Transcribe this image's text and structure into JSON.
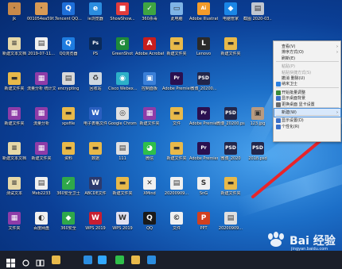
{
  "desktop": {
    "icons": [
      {
        "label": "jk",
        "color": "#c98a4a",
        "glyph": "·",
        "col": 0,
        "row": 0
      },
      {
        "label": "001054ea59f...",
        "color": "#d89a55",
        "glyph": "·",
        "col": 1,
        "row": 0
      },
      {
        "label": "Tencent QQ...",
        "color": "#1e6fd9",
        "glyph": "Q",
        "col": 2,
        "row": 0
      },
      {
        "label": "ie浏览器",
        "color": "#2b8de0",
        "glyph": "e",
        "col": 3,
        "row": 0
      },
      {
        "label": "ShowShow...",
        "color": "#e23c3c",
        "glyph": "■",
        "col": 4,
        "row": 0
      },
      {
        "label": "360杀毒",
        "color": "#3fa542",
        "glyph": "✓",
        "col": 5,
        "row": 0
      },
      {
        "label": "此电脑",
        "color": "#7fb4e6",
        "glyph": "▭",
        "col": 6,
        "row": 0
      },
      {
        "label": "Adobe Illustrat...",
        "color": "#f39b2a",
        "glyph": "Ai",
        "col": 7,
        "row": 0
      },
      {
        "label": "电脑管家",
        "color": "#1a86e6",
        "glyph": "◆",
        "col": 8,
        "row": 0
      },
      {
        "label": "截图 2020-03...",
        "color": "#c0c6d0",
        "glyph": "▤",
        "col": 9,
        "row": 0
      },
      {
        "label": "新建文本文档",
        "color": "#e6d8a8",
        "glyph": "≡",
        "col": 0,
        "row": 1
      },
      {
        "label": "2019-07-11...",
        "color": "#f0f0f0",
        "glyph": "▤",
        "col": 1,
        "row": 1
      },
      {
        "label": "QQ浏览器",
        "color": "#1e7ce0",
        "glyph": "Q",
        "col": 2,
        "row": 1
      },
      {
        "label": "PS",
        "color": "#0a2a5a",
        "glyph": "Ps",
        "col": 3,
        "row": 1
      },
      {
        "label": "GreenShot",
        "color": "#1e8a3a",
        "glyph": "G",
        "col": 4,
        "row": 1
      },
      {
        "label": "Adobe Acrobat",
        "color": "#c81e1e",
        "glyph": "A",
        "col": 5,
        "row": 1
      },
      {
        "label": "新建文件夹",
        "color": "#e8b94a",
        "glyph": "▬",
        "col": 6,
        "row": 1
      },
      {
        "label": "Lenovo",
        "color": "#2a2a2a",
        "glyph": "L",
        "col": 7,
        "row": 1
      },
      {
        "label": "新建文件夹",
        "color": "#e8b94a",
        "glyph": "▬",
        "col": 8,
        "row": 1
      },
      {
        "label": "新建文件夹",
        "color": "#e8b94a",
        "glyph": "▬",
        "col": 0,
        "row": 2
      },
      {
        "label": "流量分析 统计文件夹",
        "color": "#8e3ca8",
        "glyph": "▦",
        "col": 1,
        "row": 2
      },
      {
        "label": "encrypting",
        "color": "#d8d8d8",
        "glyph": "▤",
        "col": 2,
        "row": 2
      },
      {
        "label": "回收站",
        "color": "#cfd8e0",
        "glyph": "♻",
        "col": 3,
        "row": 2
      },
      {
        "label": "Cisco Webex...",
        "color": "#2db0c8",
        "glyph": "◉",
        "col": 4,
        "row": 2
      },
      {
        "label": "控制面板",
        "color": "#3a7fd8",
        "glyph": "▣",
        "col": 5,
        "row": 2
      },
      {
        "label": "Adobe Premiere",
        "color": "#2a1050",
        "glyph": "Pr",
        "col": 6,
        "row": 2
      },
      {
        "label": "微博_20200...",
        "color": "#22264a",
        "glyph": "PSD",
        "col": 7,
        "row": 2
      },
      {
        "label": "新建文件夹",
        "color": "#8e3ca8",
        "glyph": "▦",
        "col": 0,
        "row": 3
      },
      {
        "label": "流量分析",
        "color": "#8e3ca8",
        "glyph": "▦",
        "col": 1,
        "row": 3
      },
      {
        "label": "xpsfile",
        "color": "#e8b94a",
        "glyph": "▬",
        "col": 2,
        "row": 3
      },
      {
        "label": "电子表格文件",
        "color": "#2a5fc0",
        "glyph": "W",
        "col": 3,
        "row": 3
      },
      {
        "label": "Google Chrome",
        "color": "#e0e0e0",
        "glyph": "◎",
        "col": 4,
        "row": 3
      },
      {
        "label": "新建文件夹",
        "color": "#8e3ca8",
        "glyph": "▦",
        "col": 5,
        "row": 3
      },
      {
        "label": "文件",
        "color": "#e8b94a",
        "glyph": "▬",
        "col": 6,
        "row": 3
      },
      {
        "label": "Adobe Premiere pro",
        "color": "#2a1050",
        "glyph": "Pr",
        "col": 7,
        "row": 3
      },
      {
        "label": "微博_20200.psd",
        "color": "#22264a",
        "glyph": "PSD",
        "col": 8,
        "row": 3
      },
      {
        "label": "123.jpg",
        "color": "#b89a80",
        "glyph": "▣",
        "col": 9,
        "row": 3
      },
      {
        "label": "新建文本文档",
        "color": "#e6d8a8",
        "glyph": "≡",
        "col": 0,
        "row": 4
      },
      {
        "label": "新建文件夹",
        "color": "#8e3ca8",
        "glyph": "▦",
        "col": 1,
        "row": 4
      },
      {
        "label": "资料",
        "color": "#e8b94a",
        "glyph": "▬",
        "col": 2,
        "row": 4
      },
      {
        "label": "数据",
        "color": "#e8b94a",
        "glyph": "▬",
        "col": 3,
        "row": 4
      },
      {
        "label": "111",
        "color": "#e0e0e0",
        "glyph": "▤",
        "col": 4,
        "row": 4
      },
      {
        "label": "微信",
        "color": "#2fbf4a",
        "glyph": "◕",
        "col": 5,
        "row": 4
      },
      {
        "label": "新建文件夹",
        "color": "#e8b94a",
        "glyph": "▬",
        "col": 6,
        "row": 4
      },
      {
        "label": "Adobe Premiere...",
        "color": "#2a1050",
        "glyph": "Pr",
        "col": 7,
        "row": 4
      },
      {
        "label": "微博_2020",
        "color": "#22264a",
        "glyph": "PSD",
        "col": 8,
        "row": 4
      },
      {
        "label": "2018.psd",
        "color": "#22264a",
        "glyph": "PSD",
        "col": 9,
        "row": 4
      },
      {
        "label": "测试文本",
        "color": "#e6d8a8",
        "glyph": "≡",
        "col": 0,
        "row": 5
      },
      {
        "label": "Mxb2233",
        "color": "#f0f0f0",
        "glyph": "▤",
        "col": 1,
        "row": 5
      },
      {
        "label": "360安全卫士",
        "color": "#2fa84a",
        "glyph": "✓",
        "col": 2,
        "row": 5
      },
      {
        "label": "ABCDE文件",
        "color": "#2c3a6e",
        "glyph": "W",
        "col": 3,
        "row": 5
      },
      {
        "label": "新建文件夹",
        "color": "#e8b94a",
        "glyph": "▬",
        "col": 4,
        "row": 5
      },
      {
        "label": "XMind",
        "color": "#f0f0f0",
        "glyph": "✕",
        "col": 5,
        "row": 5
      },
      {
        "label": "20200909...",
        "color": "#f0f0f0",
        "glyph": "▤",
        "col": 6,
        "row": 5
      },
      {
        "label": "SnG",
        "color": "#f0f0f0",
        "glyph": "S",
        "col": 7,
        "row": 5
      },
      {
        "label": "新建文件夹",
        "color": "#e8b94a",
        "glyph": "▬",
        "col": 8,
        "row": 5
      },
      {
        "label": "文件夹",
        "color": "#8e3ca8",
        "glyph": "▦",
        "col": 0,
        "row": 6
      },
      {
        "label": "百度网盘",
        "color": "#f0f0f0",
        "glyph": "◐",
        "col": 1,
        "row": 6
      },
      {
        "label": "360安全",
        "color": "#2fa84a",
        "glyph": "◆",
        "col": 2,
        "row": 6
      },
      {
        "label": "WPS 2019",
        "color": "#c81e32",
        "glyph": "W",
        "col": 3,
        "row": 6
      },
      {
        "label": "WPS 2019",
        "color": "#e0e0f0",
        "glyph": "W",
        "col": 4,
        "row": 6
      },
      {
        "label": "QQ",
        "color": "#1a1a1a",
        "glyph": "Q",
        "col": 5,
        "row": 6
      },
      {
        "label": "文件",
        "color": "#f0f0f0",
        "glyph": "©",
        "col": 6,
        "row": 6
      },
      {
        "label": "PPT",
        "color": "#d04020",
        "glyph": "P",
        "col": 7,
        "row": 6
      },
      {
        "label": "20200909...",
        "color": "#e0e0e0",
        "glyph": "▤",
        "col": 8,
        "row": 6
      }
    ]
  },
  "context_menu": {
    "items": [
      {
        "label": "查看(V)",
        "type": "item",
        "submenu": true,
        "icon": null,
        "disabled": false
      },
      {
        "label": "排序方式(O)",
        "type": "item",
        "submenu": true,
        "icon": null,
        "disabled": false
      },
      {
        "label": "刷新(E)",
        "type": "item",
        "submenu": false,
        "icon": null,
        "disabled": false
      },
      {
        "type": "separator"
      },
      {
        "label": "粘贴(P)",
        "type": "item",
        "submenu": false,
        "icon": null,
        "disabled": true
      },
      {
        "label": "粘贴快捷方式(S)",
        "type": "item",
        "submenu": false,
        "icon": null,
        "disabled": true
      },
      {
        "label": "撤消 删除(U)",
        "type": "item",
        "submenu": false,
        "icon": null,
        "disabled": false
      },
      {
        "label": "纳米卫士",
        "type": "item",
        "submenu": false,
        "icon": "#2a7fe0",
        "disabled": false
      },
      {
        "type": "separator"
      },
      {
        "label": "开始批量调整",
        "type": "item",
        "submenu": false,
        "icon": "#3a8a3a",
        "disabled": false
      },
      {
        "label": "显示桌面背景",
        "type": "item",
        "submenu": false,
        "icon": "#3a6fc8",
        "disabled": false
      },
      {
        "label": "更换桌面 显卡设置",
        "type": "item",
        "submenu": false,
        "icon": "#6a6a6a",
        "disabled": false
      },
      {
        "type": "separator"
      },
      {
        "label": "新建(W)",
        "type": "item",
        "submenu": true,
        "icon": null,
        "disabled": false,
        "highlighted": true
      },
      {
        "type": "separator"
      },
      {
        "label": "显示设置(D)",
        "type": "item",
        "submenu": false,
        "icon": "#3a6fc8",
        "disabled": false
      },
      {
        "label": "个性化(R)",
        "type": "item",
        "submenu": false,
        "icon": "#3a6fc8",
        "disabled": false
      }
    ]
  },
  "taskbar": {
    "items": [
      {
        "name": "start-button",
        "icon": "windows-logo-icon",
        "color": "#ffffff"
      },
      {
        "name": "search-button",
        "icon": "search-circle-icon",
        "color": "#ffffff"
      },
      {
        "name": "task-view-button",
        "icon": "task-view-icon",
        "color": "#ffffff"
      },
      {
        "name": "taskbar-explorer",
        "icon": "folder-icon",
        "color": "#e8b94a"
      },
      {
        "name": "taskbar-app-blue",
        "icon": "edge-icon",
        "color": "#2b8de0"
      },
      {
        "name": "taskbar-ps",
        "icon": "photoshop-icon",
        "color": "#31a8ff"
      },
      {
        "name": "taskbar-wechat",
        "icon": "wechat-icon",
        "color": "#2fbf4a"
      },
      {
        "name": "taskbar-folder",
        "icon": "folder-icon",
        "color": "#e8b94a"
      },
      {
        "name": "taskbar-ie",
        "icon": "ie-icon",
        "color": "#2b8de0"
      }
    ]
  },
  "watermark": {
    "brand": "Bai 经验",
    "url": "jingyan.baidu.com",
    "accent": "#ffffff"
  },
  "annotation_arrow": {
    "color": "#e8242a"
  }
}
